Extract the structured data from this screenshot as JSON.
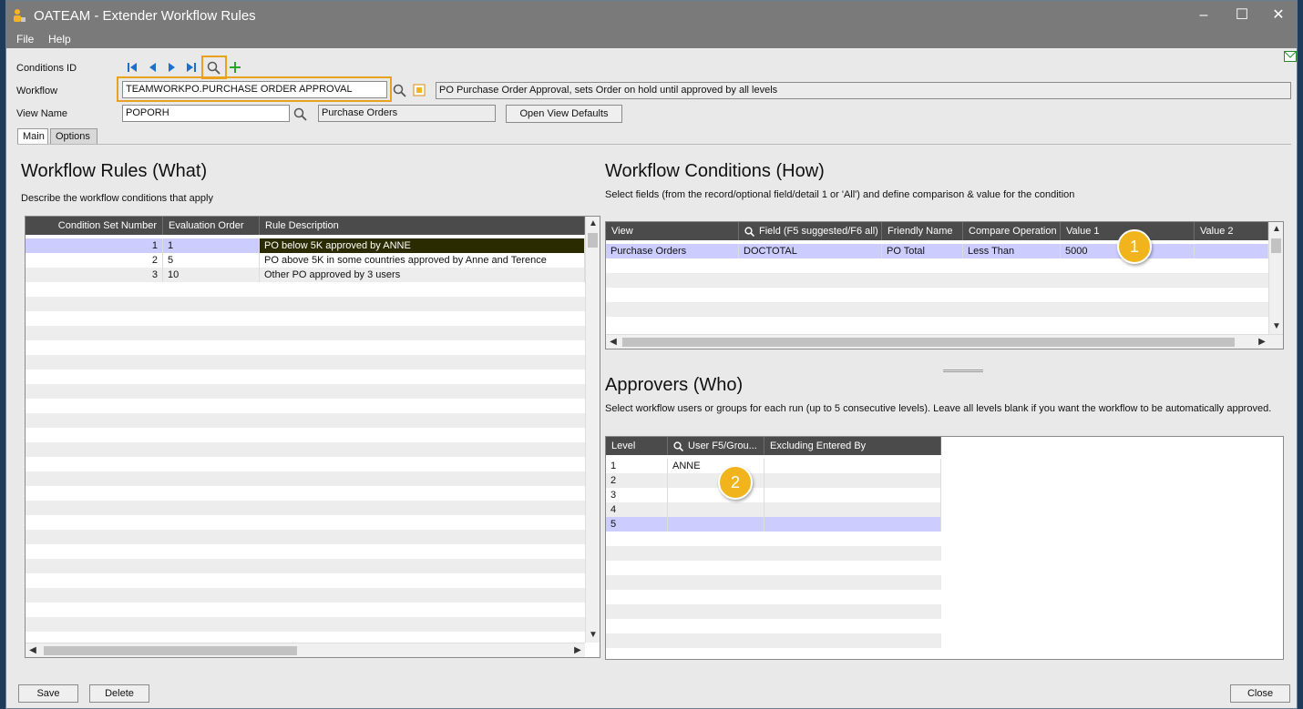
{
  "window": {
    "title": "OATEAM - Extender Workflow Rules",
    "minimize": "–",
    "maximize": "☐",
    "close": "✕"
  },
  "menu": {
    "file": "File",
    "help": "Help"
  },
  "form": {
    "conditions_id_label": "Conditions ID",
    "workflow_label": "Workflow",
    "workflow_value": "TEAMWORKPO.PURCHASE ORDER APPROVAL",
    "workflow_description": "PO Purchase Order Approval, sets Order on hold until approved by all levels",
    "view_name_label": "View Name",
    "view_name_value": "POPORH",
    "view_description": "Purchase Orders",
    "open_view_defaults": "Open View Defaults"
  },
  "tabs": {
    "main": "Main",
    "options": "Options"
  },
  "rules": {
    "title": "Workflow Rules (What)",
    "subtitle": "Describe the workflow conditions that apply",
    "columns": [
      "Condition Set Number",
      "Evaluation Order",
      "Rule Description"
    ],
    "rows": [
      {
        "set": "1",
        "order": "1",
        "desc": "PO below 5K approved by ANNE"
      },
      {
        "set": "2",
        "order": "5",
        "desc": "PO above 5K in some countries approved by Anne and Terence"
      },
      {
        "set": "3",
        "order": "10",
        "desc": "Other PO approved by 3 users"
      }
    ]
  },
  "conditions": {
    "title": "Workflow Conditions (How)",
    "subtitle": "Select fields (from the record/optional field/detail 1 or 'All') and define comparison & value for the condition",
    "columns": [
      "View",
      "Field (F5 suggested/F6 all)",
      "Friendly Name",
      "Compare Operation",
      "Value 1",
      "Value 2"
    ],
    "rows": [
      {
        "view": "Purchase Orders",
        "field": "DOCTOTAL",
        "friendly": "PO Total",
        "compare": "Less Than",
        "value1": "5000",
        "value2": ""
      }
    ]
  },
  "approvers": {
    "title": "Approvers (Who)",
    "subtitle": "Select workflow users or groups for each run (up to 5 consecutive levels). Leave all levels blank if you want the workflow to be automatically approved.",
    "columns": [
      "Level",
      "User F5/Grou...",
      "Excluding Entered By"
    ],
    "rows": [
      {
        "level": "1",
        "user": "ANNE"
      },
      {
        "level": "2",
        "user": ""
      },
      {
        "level": "3",
        "user": ""
      },
      {
        "level": "4",
        "user": ""
      },
      {
        "level": "5",
        "user": ""
      }
    ]
  },
  "badges": {
    "one": "1",
    "two": "2"
  },
  "buttons": {
    "save": "Save",
    "delete": "Delete",
    "close": "Close"
  },
  "colors": {
    "highlight": "#e8a21e",
    "badge": "#f1b41d",
    "selected_row": "#ccccff",
    "grid_header": "#4b4b4b"
  }
}
